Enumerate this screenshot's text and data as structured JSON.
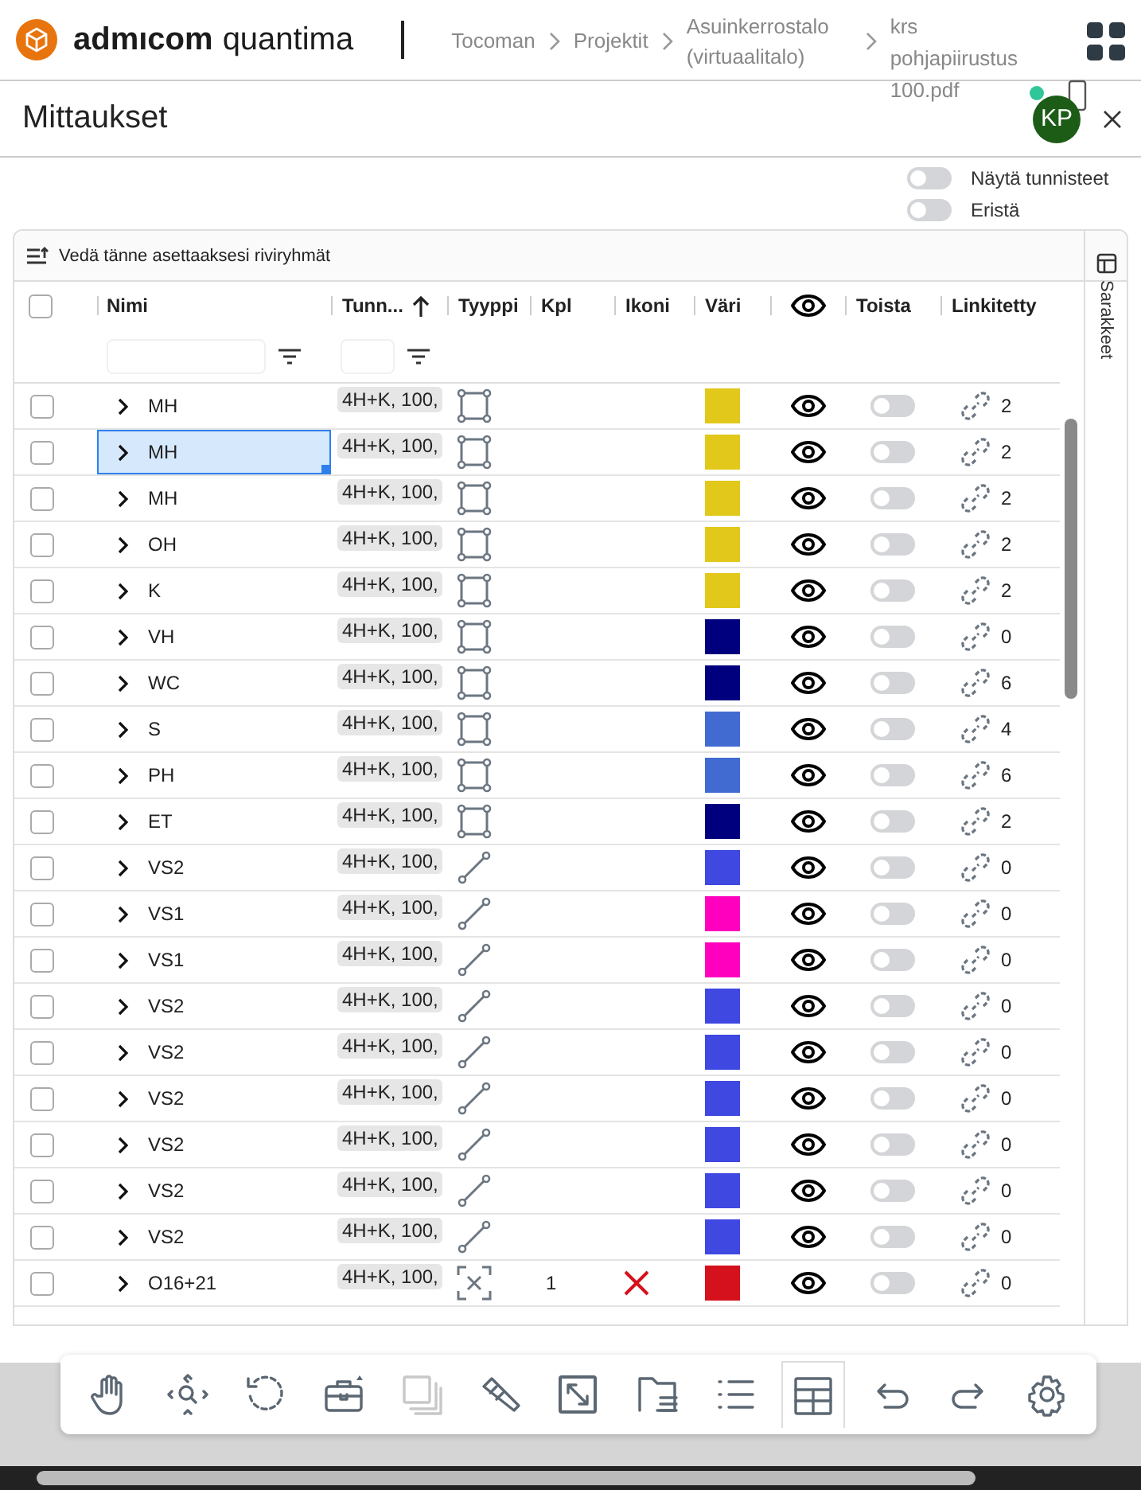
{
  "header": {
    "logo_text": "admıcom",
    "product": "quantima",
    "breadcrumbs": [
      "Tocoman",
      "Projektit",
      "Asuinkerrostalo (virtuaalitalo)",
      "krs pohjapiirustus 100.pdf"
    ]
  },
  "panel": {
    "title": "Mittaukset",
    "avatar": "KP",
    "online": true
  },
  "toggles": [
    {
      "label": "Näytä tunnisteet",
      "on": false
    },
    {
      "label": "Eristä",
      "on": false
    }
  ],
  "group_bar": "Vedä tänne asettaaksesi riviryhmät",
  "side_tab": "Sarakkeet",
  "columns": [
    {
      "kind": "check",
      "checked": false
    },
    {
      "kind": "text",
      "label": "Nimi",
      "filter": true
    },
    {
      "kind": "text",
      "label": "Tunn...",
      "sorted": true,
      "ascending": true,
      "filter": true
    },
    {
      "kind": "text",
      "label": "Tyyppi"
    },
    {
      "kind": "text",
      "label": "Kpl"
    },
    {
      "kind": "text",
      "label": "Ikoni"
    },
    {
      "kind": "text",
      "label": "Väri"
    },
    {
      "kind": "eye"
    },
    {
      "kind": "text",
      "label": "Toista"
    },
    {
      "kind": "text",
      "label": "Linkitetty"
    }
  ],
  "rows": [
    {
      "name": "MH",
      "tag": "4H+K, 100,",
      "kind": "area",
      "color": "#e2c81a",
      "linked": "2",
      "checked": false,
      "selected": false,
      "visible": true,
      "repeat": false,
      "ikoni": false
    },
    {
      "name": "MH",
      "tag": "4H+K, 100,",
      "kind": "area",
      "color": "#e2c81a",
      "linked": "2",
      "checked": false,
      "selected": true,
      "visible": true,
      "repeat": false,
      "ikoni": false
    },
    {
      "name": "MH",
      "tag": "4H+K, 100,",
      "kind": "area",
      "color": "#e2c81a",
      "linked": "2",
      "checked": false,
      "selected": false,
      "visible": true,
      "repeat": false,
      "ikoni": false
    },
    {
      "name": "OH",
      "tag": "4H+K, 100,",
      "kind": "area",
      "color": "#e2c81a",
      "linked": "2",
      "checked": false,
      "selected": false,
      "visible": true,
      "repeat": false,
      "ikoni": false
    },
    {
      "name": "K",
      "tag": "4H+K, 100,",
      "kind": "area",
      "color": "#e2c81a",
      "linked": "2",
      "checked": false,
      "selected": false,
      "visible": true,
      "repeat": false,
      "ikoni": false
    },
    {
      "name": "VH",
      "tag": "4H+K, 100,",
      "kind": "area",
      "color": "#00007f",
      "linked": "0",
      "checked": false,
      "selected": false,
      "visible": true,
      "repeat": false,
      "ikoni": false
    },
    {
      "name": "WC",
      "tag": "4H+K, 100,",
      "kind": "area",
      "color": "#00007f",
      "linked": "6",
      "checked": false,
      "selected": false,
      "visible": true,
      "repeat": false,
      "ikoni": false
    },
    {
      "name": "S",
      "tag": "4H+K, 100,",
      "kind": "area",
      "color": "#416bd0",
      "linked": "4",
      "checked": false,
      "selected": false,
      "visible": true,
      "repeat": false,
      "ikoni": false
    },
    {
      "name": "PH",
      "tag": "4H+K, 100,",
      "kind": "area",
      "color": "#416bd0",
      "linked": "6",
      "checked": false,
      "selected": false,
      "visible": true,
      "repeat": false,
      "ikoni": false
    },
    {
      "name": "ET",
      "tag": "4H+K, 100,",
      "kind": "area",
      "color": "#00007f",
      "linked": "2",
      "checked": false,
      "selected": false,
      "visible": true,
      "repeat": false,
      "ikoni": false
    },
    {
      "name": "VS2",
      "tag": "4H+K, 100,",
      "kind": "line",
      "color": "#3f48e0",
      "linked": "0",
      "checked": false,
      "selected": false,
      "visible": true,
      "repeat": false,
      "ikoni": false
    },
    {
      "name": "VS1",
      "tag": "4H+K, 100,",
      "kind": "line",
      "color": "#ff00bf",
      "linked": "0",
      "checked": false,
      "selected": false,
      "visible": true,
      "repeat": false,
      "ikoni": false
    },
    {
      "name": "VS1",
      "tag": "4H+K, 100,",
      "kind": "line",
      "color": "#ff00bf",
      "linked": "0",
      "checked": false,
      "selected": false,
      "visible": true,
      "repeat": false,
      "ikoni": false
    },
    {
      "name": "VS2",
      "tag": "4H+K, 100,",
      "kind": "line",
      "color": "#3f48e0",
      "linked": "0",
      "checked": false,
      "selected": false,
      "visible": true,
      "repeat": false,
      "ikoni": false
    },
    {
      "name": "VS2",
      "tag": "4H+K, 100,",
      "kind": "line",
      "color": "#3f48e0",
      "linked": "0",
      "checked": false,
      "selected": false,
      "visible": true,
      "repeat": false,
      "ikoni": false
    },
    {
      "name": "VS2",
      "tag": "4H+K, 100,",
      "kind": "line",
      "color": "#3f48e0",
      "linked": "0",
      "checked": false,
      "selected": false,
      "visible": true,
      "repeat": false,
      "ikoni": false
    },
    {
      "name": "VS2",
      "tag": "4H+K, 100,",
      "kind": "line",
      "color": "#3f48e0",
      "linked": "0",
      "checked": false,
      "selected": false,
      "visible": true,
      "repeat": false,
      "ikoni": false
    },
    {
      "name": "VS2",
      "tag": "4H+K, 100,",
      "kind": "line",
      "color": "#3f48e0",
      "linked": "0",
      "checked": false,
      "selected": false,
      "visible": true,
      "repeat": false,
      "ikoni": false
    },
    {
      "name": "VS2",
      "tag": "4H+K, 100,",
      "kind": "line",
      "color": "#3f48e0",
      "linked": "0",
      "checked": false,
      "selected": false,
      "visible": true,
      "repeat": false,
      "ikoni": false
    },
    {
      "name": "O16+21",
      "tag": "4H+K, 100,",
      "kind": "point",
      "count": "1",
      "color": "#d4111c",
      "linked": "0",
      "checked": false,
      "selected": false,
      "visible": true,
      "repeat": false,
      "ikoni": true
    }
  ],
  "toolbar": [
    {
      "kind": "hand",
      "selected": false,
      "disabled": false
    },
    {
      "kind": "zoom",
      "selected": false,
      "disabled": false
    },
    {
      "kind": "rotate",
      "selected": false,
      "disabled": false
    },
    {
      "kind": "toolbox",
      "selected": false,
      "disabled": false
    },
    {
      "kind": "copy",
      "selected": false,
      "disabled": true
    },
    {
      "kind": "pencil",
      "selected": false,
      "disabled": false
    },
    {
      "kind": "expand",
      "selected": false,
      "disabled": false
    },
    {
      "kind": "folder",
      "selected": false,
      "disabled": false
    },
    {
      "kind": "list",
      "selected": false,
      "disabled": false
    },
    {
      "kind": "table",
      "selected": true,
      "disabled": false
    },
    {
      "kind": "undo",
      "selected": false,
      "disabled": false
    },
    {
      "kind": "redo",
      "selected": false,
      "disabled": false
    },
    {
      "kind": "settings",
      "selected": false,
      "disabled": false
    }
  ]
}
